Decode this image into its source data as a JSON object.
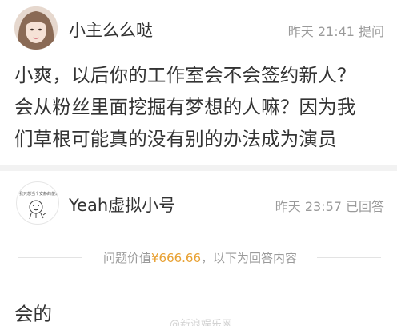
{
  "question": {
    "asker_name": "小主么么哒",
    "time": "昨天 21:41",
    "action": "提问",
    "text_lines": [
      "小爽，以后你的工作室会不会签约新人？",
      "会从粉丝里面挖掘有梦想的人嘛？因为我",
      "们草根可能真的没有别的办法成为演员"
    ]
  },
  "answer": {
    "answerer_name": "Yeah虚拟小号",
    "avatar_text": "我只想当个安静的傻逼",
    "time": "昨天 23:57",
    "status": "已回答",
    "price_prefix": "问题价值",
    "price_value": "¥666.66",
    "price_suffix": "，以下为回答内容",
    "text": "会的",
    "watermark": "@新浪娱乐网"
  },
  "colors": {
    "text": "#333333",
    "meta": "#9a9a9a",
    "price": "#e8a133",
    "band": "#f2f2f2"
  }
}
